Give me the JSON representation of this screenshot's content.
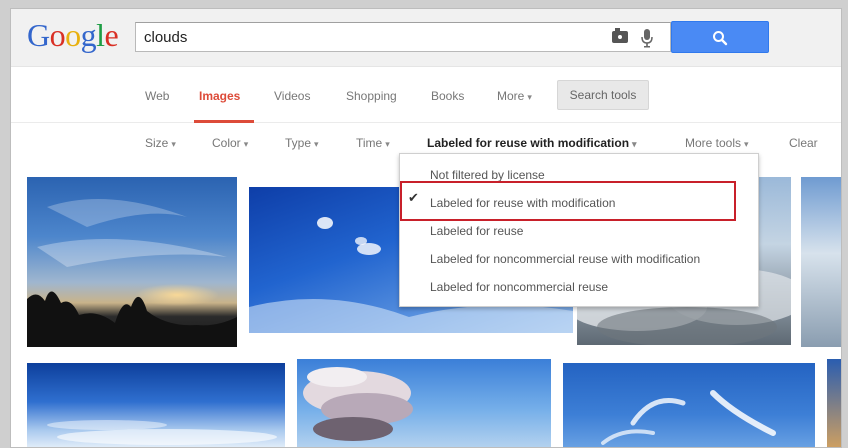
{
  "logo": {
    "letters": [
      "G",
      "o",
      "o",
      "g",
      "l",
      "e"
    ],
    "colors": [
      "#3366cc",
      "#d93025",
      "#e8b00e",
      "#3366cc",
      "#1f9e45",
      "#d93025"
    ]
  },
  "search": {
    "query": "clouds",
    "button_color": "#4a8af4"
  },
  "nav": {
    "items": [
      {
        "label": "Web",
        "active": false
      },
      {
        "label": "Images",
        "active": true
      },
      {
        "label": "Videos",
        "active": false
      },
      {
        "label": "Shopping",
        "active": false
      },
      {
        "label": "Books",
        "active": false
      },
      {
        "label": "More",
        "active": false
      }
    ],
    "more_caret": "▾",
    "search_tools_label": "Search tools",
    "active_color": "#dd4b39"
  },
  "tools": {
    "size": "Size",
    "color": "Color",
    "type": "Type",
    "time": "Time",
    "usage_rights": "Labeled for reuse with modification",
    "more_tools": "More tools",
    "clear": "Clear",
    "caret": "▾"
  },
  "usage_menu": {
    "options": [
      "Not filtered by license",
      "Labeled for reuse with modification",
      "Labeled for reuse",
      "Labeled for noncommercial reuse with modification",
      "Labeled for noncommercial reuse"
    ],
    "selected_index": 1,
    "check_glyph": "✔",
    "highlight_color": "#c8202a"
  }
}
